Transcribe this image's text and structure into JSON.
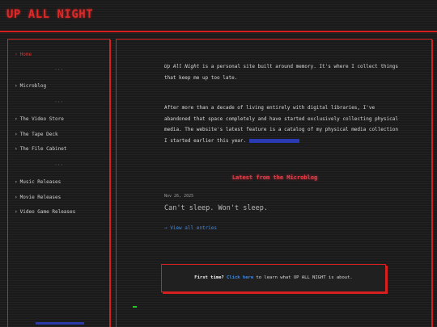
{
  "header": {
    "title": "UP ALL NIGHT"
  },
  "sidebar": {
    "chevron": "›",
    "separator": "···",
    "items": [
      {
        "label": "Home",
        "active": true
      },
      {
        "label": "Microblog"
      },
      {
        "label": "The Video Store"
      },
      {
        "label": "The Tape Deck"
      },
      {
        "label": "The File Cabinet"
      },
      {
        "label": "Music Releases"
      },
      {
        "label": "Movie Releases"
      },
      {
        "label": "Video Game Releases"
      }
    ]
  },
  "main": {
    "intro": {
      "site_name": "Up All Night",
      "text": " is a personal site built around memory. It's where I collect things that keep me up too late."
    },
    "body": "After more than a decade of living entirely with digital libraries, I've abandoned that space completely and have started exclusively collecting physical media. The website's latest feature is a catalog of my physical media collection I started earlier this year.",
    "latest": {
      "heading": "Latest from the Microblog",
      "date": "Nov 26, 2025",
      "title": "Can't sleep. Won't sleep.",
      "view_all": "→ View all entries"
    },
    "notice": {
      "lead": "First time?",
      "link": "Click here",
      "rest": " to learn what UP ALL NIGHT is about."
    }
  },
  "colors": {
    "accent": "#d62020",
    "link": "#3c8ae8",
    "background": "#1a1a1a"
  }
}
